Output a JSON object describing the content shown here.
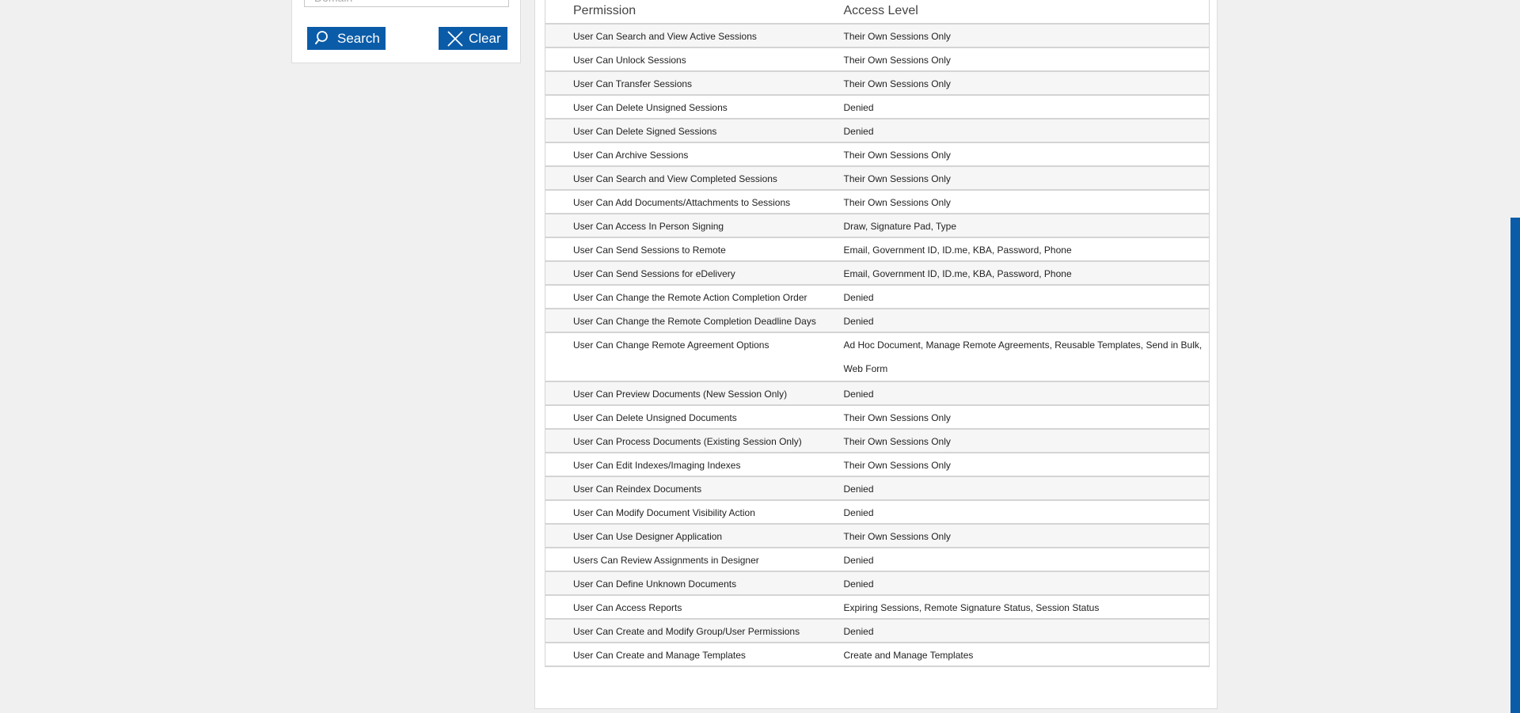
{
  "search": {
    "domain_placeholder": "Domain",
    "search_label": "Search",
    "clear_label": "Clear"
  },
  "table": {
    "headers": {
      "permission": "Permission",
      "access_level": "Access Level"
    },
    "rows": [
      {
        "permission": "User Can Search and View Active Sessions",
        "access": "Their Own Sessions Only"
      },
      {
        "permission": "User Can Unlock Sessions",
        "access": "Their Own Sessions Only"
      },
      {
        "permission": "User Can Transfer Sessions",
        "access": "Their Own Sessions Only"
      },
      {
        "permission": "User Can Delete Unsigned Sessions",
        "access": "Denied"
      },
      {
        "permission": "User Can Delete Signed Sessions",
        "access": "Denied"
      },
      {
        "permission": "User Can Archive Sessions",
        "access": "Their Own Sessions Only"
      },
      {
        "permission": "User Can Search and View Completed Sessions",
        "access": "Their Own Sessions Only"
      },
      {
        "permission": "User Can Add Documents/Attachments to Sessions",
        "access": "Their Own Sessions Only"
      },
      {
        "permission": "User Can Access In Person Signing",
        "access": "Draw, Signature Pad, Type"
      },
      {
        "permission": "User Can Send Sessions to Remote",
        "access": "Email, Government ID, ID.me, KBA, Password, Phone"
      },
      {
        "permission": "User Can Send Sessions for eDelivery",
        "access": "Email, Government ID, ID.me, KBA, Password, Phone"
      },
      {
        "permission": "User Can Change the Remote Action Completion Order",
        "access": "Denied"
      },
      {
        "permission": "User Can Change the Remote Completion Deadline Days",
        "access": "Denied"
      },
      {
        "permission": "User Can Change Remote Agreement Options",
        "access": "Ad Hoc Document, Manage Remote Agreements, Reusable Templates, Send in Bulk, Web Form"
      },
      {
        "permission": "User Can Preview Documents (New Session Only)",
        "access": "Denied"
      },
      {
        "permission": "User Can Delete Unsigned Documents",
        "access": "Their Own Sessions Only"
      },
      {
        "permission": "User Can Process Documents (Existing Session Only)",
        "access": "Their Own Sessions Only"
      },
      {
        "permission": "User Can Edit Indexes/Imaging Indexes",
        "access": "Their Own Sessions Only"
      },
      {
        "permission": "User Can Reindex Documents",
        "access": "Denied"
      },
      {
        "permission": "User Can Modify Document Visibility Action",
        "access": "Denied"
      },
      {
        "permission": "User Can Use Designer Application",
        "access": "Their Own Sessions Only"
      },
      {
        "permission": "Users Can Review Assignments in Designer",
        "access": "Denied"
      },
      {
        "permission": "User Can Define Unknown Documents",
        "access": "Denied"
      },
      {
        "permission": "User Can Access Reports",
        "access": "Expiring Sessions, Remote Signature Status, Session Status"
      },
      {
        "permission": "User Can Create and Modify Group/User Permissions",
        "access": "Denied"
      },
      {
        "permission": "User Can Create and Manage Templates",
        "access": "Create and Manage Templates"
      }
    ]
  },
  "colors": {
    "accent": "#0b5ca8",
    "page_background": "#f0f0f0",
    "row_alt": "#f6f6f6"
  }
}
